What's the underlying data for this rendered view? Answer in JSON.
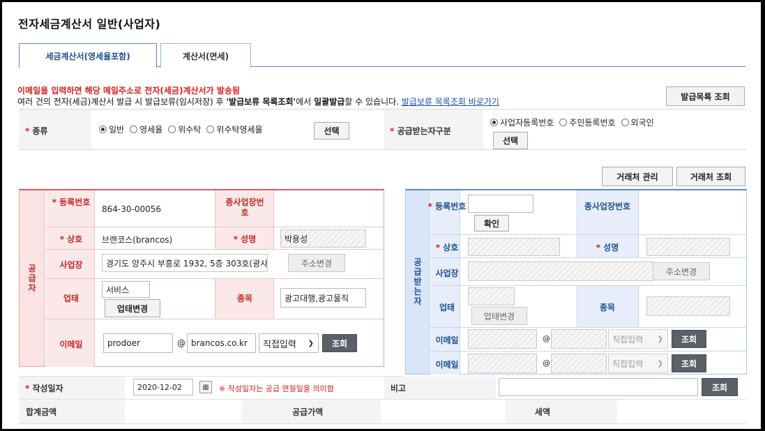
{
  "page": {
    "title": "전자세금계산서 일반(사업자)",
    "tabs": [
      {
        "label": "세금계산서(영세율포함)",
        "active": true
      },
      {
        "label": "계산서(면세)",
        "active": false
      }
    ],
    "notice_red": "이메일을 입력하면 해당 메일주소로 전자(세금)계산서가 발송됨",
    "notice_line": {
      "part1": "여러 건의 전자(세금)계산서 발급 시 발급보류(임시저장) 후 ",
      "bold1": "'발급보류 목록조회'",
      "part2": "에서 ",
      "bold2": "일괄발급",
      "part3": "할 수 있습니다. ",
      "link": "발급보류 목록조회 바로가기"
    },
    "issue_list_button": "발급목록 조회"
  },
  "type_row": {
    "label": "종류",
    "options": [
      "일반",
      "영세율",
      "위수탁",
      "위수탁영세율"
    ],
    "selected": "일반",
    "select_button": "선택"
  },
  "recipient_type_row": {
    "label": "공급받는자구분",
    "options": [
      "사업자등록번호",
      "주민등록번호",
      "외국인"
    ],
    "selected": "사업자등록번호",
    "select_button": "선택"
  },
  "partner_buttons": {
    "manage": "거래처 관리",
    "lookup": "거래처 조회"
  },
  "supplier": {
    "side_label": "공급자",
    "reg_no_label": "등록번호",
    "reg_no": "864-30-00056",
    "sub_biz_label": "종사업장번호",
    "name_label": "상호",
    "name": "브랜코스(brancos)",
    "ceo_label": "성명",
    "ceo": "박용성",
    "address_label": "사업장",
    "address": "경기도 양주시 부흥로 1932, 5층 303호(광사",
    "address_button": "주소변경",
    "biz_type_label": "업태",
    "biz_type": "서비스",
    "biz_type_button": "업태변경",
    "biz_item_label": "종목",
    "biz_item": "광고대행,광고물직",
    "email_label": "이메일",
    "email_id": "prodoer",
    "email_at": "@",
    "email_domain": "brancos.co.kr",
    "email_select": "직접입력",
    "email_button": "조회"
  },
  "receiver": {
    "side_label": "공급받는자",
    "reg_no_label": "등록번호",
    "confirm_button": "확인",
    "sub_biz_label": "종사업장번호",
    "name_label": "상호",
    "ceo_label": "성명",
    "address_label": "사업장",
    "address_button": "주소변경",
    "biz_type_label": "업태",
    "biz_type_button": "업태변경",
    "biz_item_label": "종목",
    "email_label": "이메일",
    "email_at": "@",
    "email_select": "직접입력",
    "email_button": "조회",
    "email2_label": "이메일",
    "email2_at": "@",
    "email2_select": "직접입력",
    "email2_button": "조회"
  },
  "write_date": {
    "label": "작성일자",
    "value": "2020-12-02",
    "note": "※ 작성일자는 공급 연월일을 의미함"
  },
  "remark": {
    "label": "비고",
    "button": "조회"
  },
  "totals": {
    "total_label": "합계금액",
    "supply_label": "공급가액",
    "tax_label": "세액"
  },
  "colors": {
    "accent_red": "#d62020",
    "supplier_border": "#e05a5a",
    "receiver_border": "#5a88c4",
    "link_blue": "#1a4fb6"
  }
}
